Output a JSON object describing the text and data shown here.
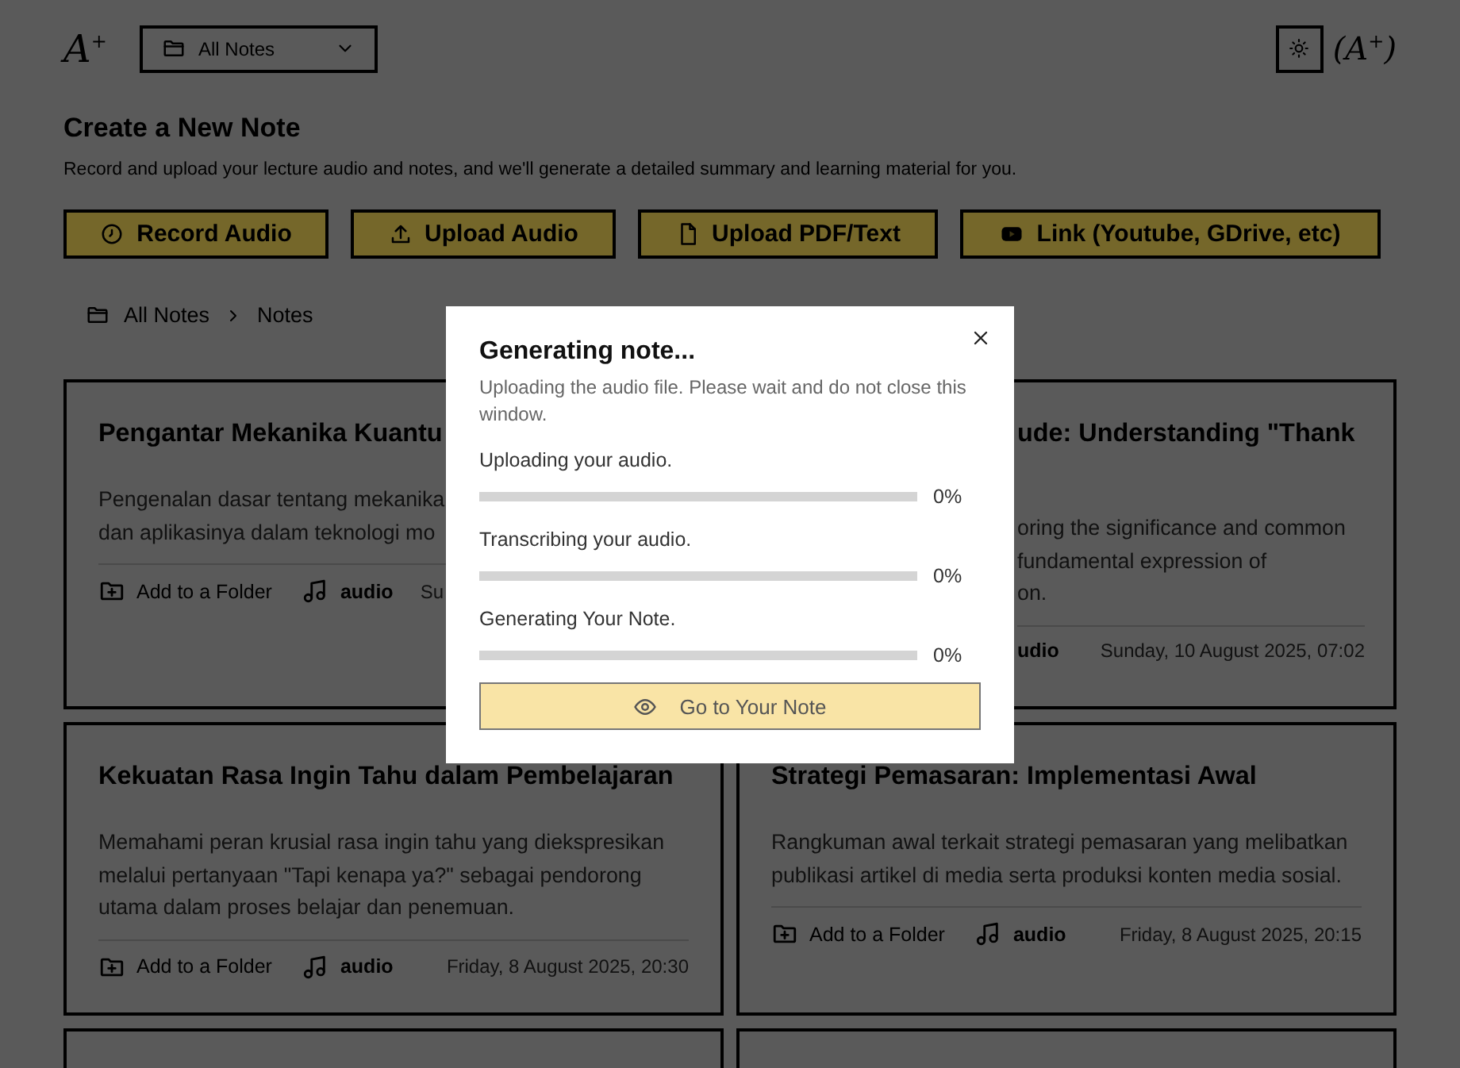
{
  "header": {
    "logo": "A$^{+}$",
    "folder_select": {
      "value": "All Notes"
    },
    "profile_logo": "(A$^{+}$)"
  },
  "intro": {
    "title": "Create a New Note",
    "subtitle": "Record and upload your lecture audio and notes, and we'll generate a detailed summary and learning material for you."
  },
  "actions": [
    {
      "label": "Record Audio",
      "kind": "record"
    },
    {
      "label": "Upload Audio",
      "kind": "upload"
    },
    {
      "label": "Upload PDF/Text",
      "kind": "file"
    },
    {
      "label": "Link (Youtube, GDrive, etc)",
      "kind": "video"
    }
  ],
  "breadcrumb": [
    "All Notes",
    "Notes"
  ],
  "cards": [
    {
      "kind": "left",
      "title": "Pengantar Mekanika Kuantu",
      "description_lines": [
        "Pengenalan dasar tentang mekanika",
        "dan aplikasinya dalam teknologi mo"
      ],
      "folder_label": "Add to a Folder",
      "type_icon": true,
      "type_label": "audio",
      "date": "Su"
    },
    {
      "kind": "right",
      "title": "ude: Understanding \"Thank",
      "description_lines": [
        "oring the significance and common",
        "fundamental expression of",
        "on."
      ],
      "type_icon": false,
      "type_label": "udio",
      "date": "Sunday, 10 August 2025, 07:02"
    },
    {
      "kind": "full",
      "title": "Kekuatan Rasa Ingin Tahu dalam Pembelajaran",
      "description_lines": [
        "Memahami peran krusial rasa ingin tahu yang diekspresikan",
        "melalui pertanyaan \"Tapi kenapa ya?\" sebagai pendorong",
        "utama dalam proses belajar dan penemuan."
      ],
      "folder_label": "Add to a Folder",
      "type_icon": true,
      "type_label": "audio",
      "date": "Friday, 8 August 2025, 20:30"
    },
    {
      "kind": "full",
      "title": "Strategi Pemasaran: Implementasi Awal",
      "description_lines": [
        "Rangkuman awal terkait strategi pemasaran yang melibatkan",
        "publikasi artikel di media serta produksi konten media sosial."
      ],
      "folder_label": "Add to a Folder",
      "type_icon": true,
      "type_label": "audio",
      "date": "Friday, 8 August 2025, 20:15"
    },
    {
      "kind": "empty"
    },
    {
      "kind": "empty"
    }
  ],
  "modal": {
    "title": "Generating note...",
    "message": "Uploading the audio file. Please wait and do not close this window.",
    "steps": [
      {
        "label": "Uploading your audio.",
        "level": 0,
        "reading": "0%"
      },
      {
        "label": "Transcribing your audio.",
        "level": 0,
        "reading": "0%"
      },
      {
        "label": "Generating Your Note.",
        "level": 0,
        "reading": "0%"
      }
    ],
    "button": "Go to Your Note"
  }
}
